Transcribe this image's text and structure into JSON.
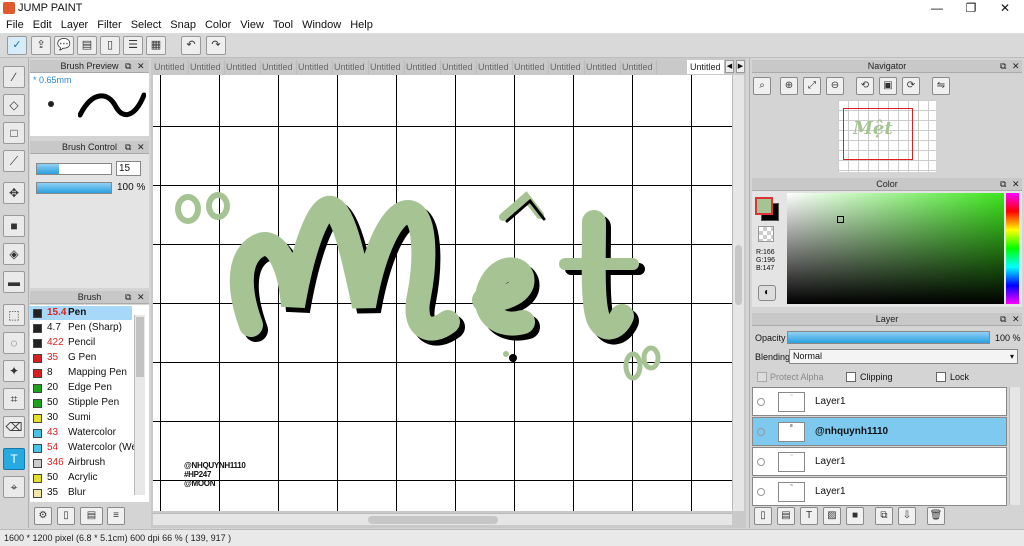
{
  "app": {
    "title": "JUMP PAINT"
  },
  "window_controls": {
    "minimize": "—",
    "maximize": "❐",
    "close": "✕"
  },
  "menu": [
    "File",
    "Edit",
    "Layer",
    "Filter",
    "Select",
    "Snap",
    "Color",
    "View",
    "Tool",
    "Window",
    "Help"
  ],
  "panels": {
    "brush_preview": {
      "title": "Brush Preview",
      "size_label": "* 0.65mm"
    },
    "brush_control": {
      "title": "Brush Control",
      "size_value": "15",
      "opacity_value": "100 %"
    },
    "brush": {
      "title": "Brush",
      "items": [
        {
          "size": "15.4",
          "name": "Pen",
          "color": "#222222",
          "selected": true
        },
        {
          "size": "4.7",
          "name": "Pen (Sharp)",
          "color": "#222222"
        },
        {
          "size": "422",
          "name": "Pencil",
          "color": "#222222"
        },
        {
          "size": "35",
          "name": "G Pen",
          "color": "#d42020"
        },
        {
          "size": "8",
          "name": "Mapping Pen",
          "color": "#d42020"
        },
        {
          "size": "20",
          "name": "Edge Pen",
          "color": "#1aa31a"
        },
        {
          "size": "50",
          "name": "Stipple Pen",
          "color": "#1aa31a"
        },
        {
          "size": "30",
          "name": "Sumi",
          "color": "#e6df2a"
        },
        {
          "size": "43",
          "name": "Watercolor",
          "color": "#49c2e6"
        },
        {
          "size": "54",
          "name": "Watercolor (We",
          "color": "#49c2e6"
        },
        {
          "size": "346",
          "name": "Airbrush",
          "color": "#cccccc"
        },
        {
          "size": "50",
          "name": "Acrylic",
          "color": "#e6df2a"
        },
        {
          "size": "35",
          "name": "Blur",
          "color": "#f2e7a6"
        }
      ]
    },
    "navigator": {
      "title": "Navigator"
    },
    "color": {
      "title": "Color",
      "r": "R:166",
      "g": "G:196",
      "b": "B:147"
    },
    "layer": {
      "title": "Layer",
      "opacity_label": "Opacity",
      "opacity_value": "100 %",
      "blending_label": "Blending",
      "blending_value": "Normal",
      "protect_alpha": "Protect Alpha",
      "clipping": "Clipping",
      "lock": "Lock",
      "layers": [
        {
          "name": "Layer1",
          "selected": false
        },
        {
          "name": "@nhquynh1110",
          "selected": true
        },
        {
          "name": "Layer1",
          "selected": false
        },
        {
          "name": "Layer1",
          "selected": false
        }
      ]
    }
  },
  "tabs": [
    "Untitled",
    "Untitled",
    "Untitled",
    "Untitled",
    "Untitled",
    "Untitled",
    "Untitled",
    "Untitled",
    "Untitled",
    "Untitled",
    "Untitled",
    "Untitled",
    "Untitled",
    "Untitled",
    "Untitled"
  ],
  "canvas": {
    "lettering": "Mệt",
    "signature_lines": [
      "@NHQUYNH1110",
      "#HP247",
      "@MOON"
    ],
    "accent_color": "#a6c493"
  },
  "status": "1600 * 1200 pixel   (6.8 * 5.1cm)   600 dpi   66 %   ( 139, 917 )"
}
